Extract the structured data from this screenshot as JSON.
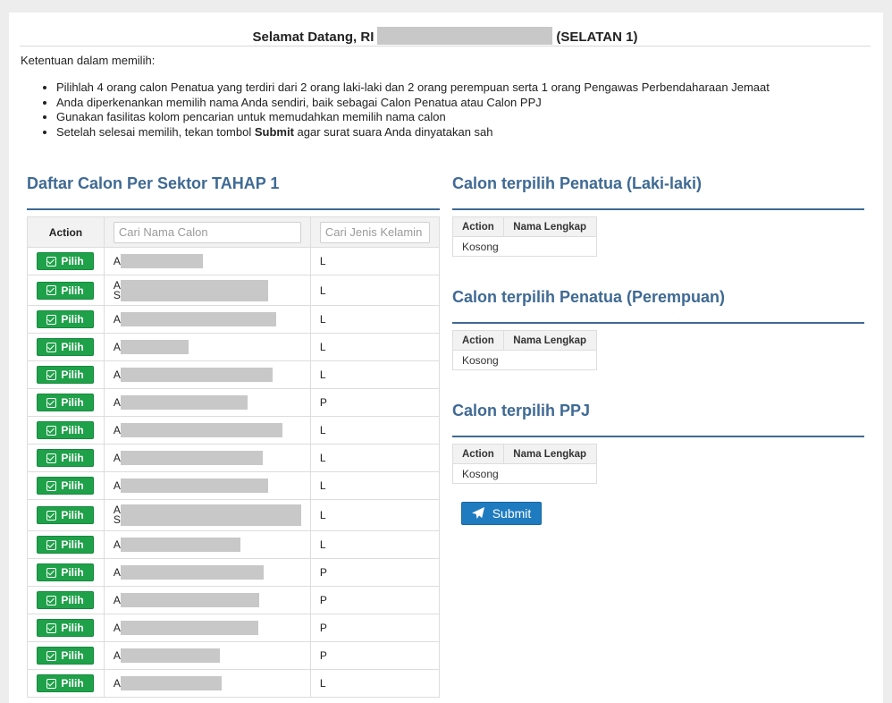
{
  "welcome": {
    "prefix": "Selamat Datang, RI",
    "suffix": "(SELATAN 1)"
  },
  "rules": {
    "title": "Ketentuan dalam memilih:",
    "items": [
      "Pilihlah 4 orang calon Penatua yang terdiri dari 2 orang laki-laki dan 2 orang perempuan serta 1 orang Pengawas Perbendaharaan Jemaat",
      "Anda diperkenankan memilih nama Anda sendiri, baik sebagai Calon Penatua atau Calon PPJ",
      "Gunakan fasilitas kolom pencarian untuk memudahkan memilih nama calon"
    ],
    "last_before": "Setelah selesai memilih, tekan tombol ",
    "last_bold": "Submit",
    "last_after": " agar surat suara Anda dinyatakan sah"
  },
  "list": {
    "title": "Daftar Calon Per Sektor TAHAP 1",
    "col_action": "Action",
    "search_name_placeholder": "Cari Nama Calon",
    "search_gender_placeholder": "Cari Jenis Kelamin",
    "pick_label": "Pilih",
    "rows": [
      {
        "p1": "A",
        "p2": "",
        "gender": "L"
      },
      {
        "p1": "A",
        "p2": "S",
        "gender": "L"
      },
      {
        "p1": "A",
        "p2": "",
        "gender": "L"
      },
      {
        "p1": "A",
        "p2": "",
        "gender": "L"
      },
      {
        "p1": "A",
        "p2": "",
        "gender": "L"
      },
      {
        "p1": "A",
        "p2": "",
        "gender": "P"
      },
      {
        "p1": "A",
        "p2": "",
        "gender": "L"
      },
      {
        "p1": "A",
        "p2": "",
        "gender": "L"
      },
      {
        "p1": "A",
        "p2": "",
        "gender": "L"
      },
      {
        "p1": "A",
        "p2": "S",
        "gender": "L"
      },
      {
        "p1": "Al",
        "p2": "",
        "gender": "L"
      },
      {
        "p1": "A",
        "p2": "",
        "gender": "P"
      },
      {
        "p1": "A",
        "p2": "",
        "gender": "P"
      },
      {
        "p1": "A",
        "p2": "",
        "gender": "P"
      },
      {
        "p1": "A",
        "p2": "",
        "gender": "P"
      },
      {
        "p1": "A",
        "p2": "",
        "gender": "L"
      }
    ]
  },
  "selected": {
    "col_action": "Action",
    "col_name": "Nama Lengkap",
    "empty": "Kosong",
    "male_title": "Calon terpilih Penatua (Laki-laki)",
    "female_title": "Calon terpilih Penatua (Perempuan)",
    "ppj_title": "Calon terpilih PPJ"
  },
  "submit_label": "Submit",
  "colors": {
    "accent": "#3f6a94",
    "pick_button": "#1fa14a",
    "submit_button": "#1f7bbf"
  },
  "icons": {
    "pick": "check-square-icon",
    "submit": "paper-plane-icon"
  }
}
